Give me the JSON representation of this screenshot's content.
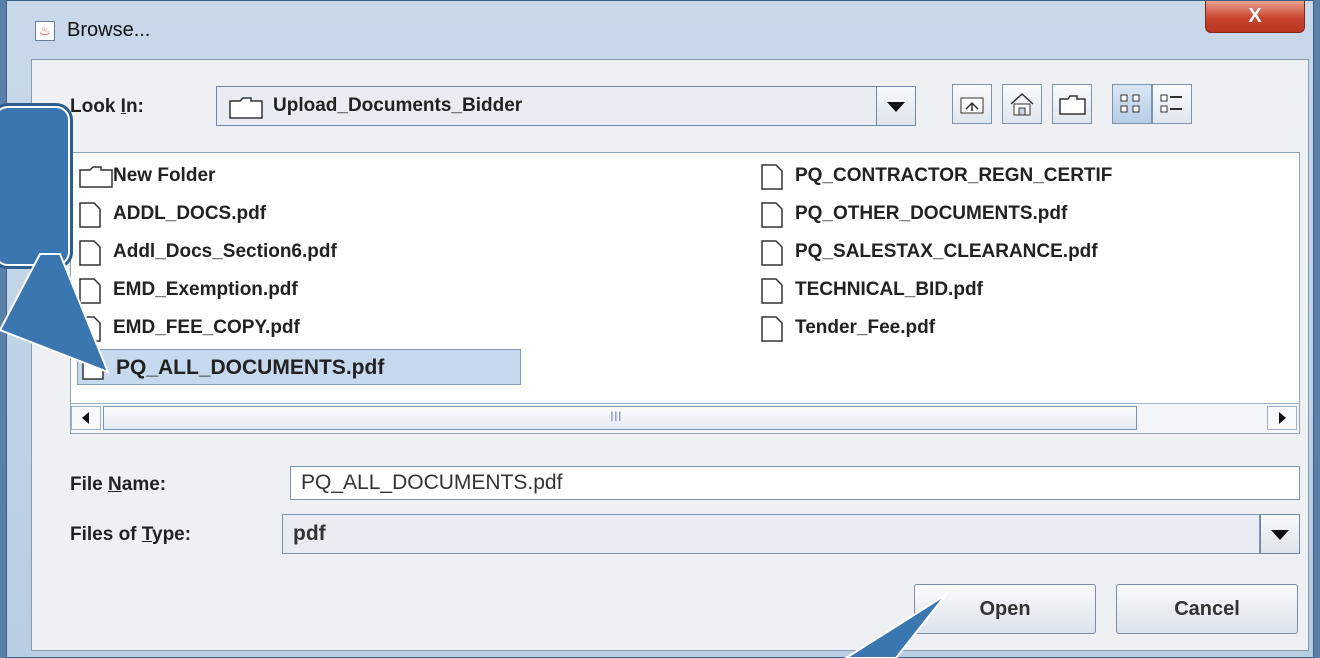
{
  "window": {
    "title": "Browse...",
    "close_label": "X"
  },
  "look_in": {
    "label_pre": "Look ",
    "label_u": "I",
    "label_post": "n:",
    "value": "Upload_Documents_Bidder"
  },
  "toolbar_icons": [
    "up-one-level-icon",
    "home-icon",
    "new-folder-icon",
    "list-view-icon",
    "details-view-icon"
  ],
  "files": {
    "col1": [
      "New Folder",
      "ADDL_DOCS.pdf",
      "Addl_Docs_Section6.pdf",
      "EMD_Exemption.pdf",
      "EMD_FEE_COPY.pdf",
      "PQ_ALL_DOCUMENTS.pdf"
    ],
    "col2": [
      "PQ_CONTRACTOR_REGN_CERTIF",
      "PQ_OTHER_DOCUMENTS.pdf",
      "PQ_SALESTAX_CLEARANCE.pdf",
      "TECHNICAL_BID.pdf",
      "Tender_Fee.pdf"
    ],
    "selected": "PQ_ALL_DOCUMENTS.pdf",
    "scroll_thumb_grip": "III"
  },
  "file_name": {
    "label_pre": "File ",
    "label_u": "N",
    "label_post": "ame:",
    "value": "PQ_ALL_DOCUMENTS.pdf"
  },
  "file_type": {
    "label_pre": "Files of ",
    "label_u": "T",
    "label_post": "ype:",
    "value": "pdf"
  },
  "buttons": {
    "open": "Open",
    "cancel": "Cancel"
  },
  "colors": {
    "callout": "#3a76b0",
    "selection": "#c7d9ee",
    "close_button": "#c9452f"
  }
}
